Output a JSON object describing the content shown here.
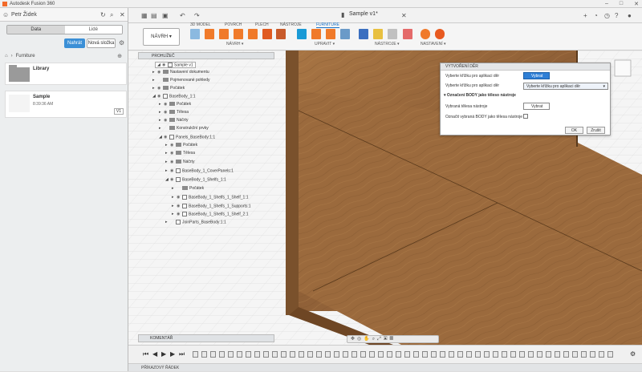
{
  "window": {
    "title": "Autodesk Fusion 360"
  },
  "data_panel": {
    "user": "Petr Židek",
    "tabs": [
      "Data",
      "Lidé"
    ],
    "buttons": {
      "upload": "Nahrát",
      "new_folder": "Nová složka"
    },
    "breadcrumb": "Furniture",
    "items": [
      {
        "name": "Library",
        "time": ""
      },
      {
        "name": "Sample",
        "time": "8:39:36 AM",
        "version": "V1"
      }
    ]
  },
  "app": {
    "tab_title": "Sample v1*"
  },
  "toolbar": {
    "workspace": "NÁVRH",
    "modes": [
      "3D MODEL",
      "POVRCH",
      "PLECH",
      "NÁSTROJE",
      "FURNITURE"
    ],
    "groups": [
      "NÁVRH",
      "UPRAVIT",
      "NÁSTROJE",
      "NASTAVENÍ"
    ]
  },
  "browser": {
    "header": "PROHLÍŽEČ",
    "nodes": [
      {
        "label": "Sample v1"
      },
      {
        "label": "Nastavení dokumentu"
      },
      {
        "label": "Pojmenované pohledy"
      },
      {
        "label": "Počátek"
      },
      {
        "label": "BaseBody_1:1"
      },
      {
        "label": "Počátek"
      },
      {
        "label": "Tělesa"
      },
      {
        "label": "Náčrty"
      },
      {
        "label": "Konstrukční prvky"
      },
      {
        "label": "Panels_BaseBody:1:1"
      },
      {
        "label": "Počátek"
      },
      {
        "label": "Tělesa"
      },
      {
        "label": "Náčrty"
      },
      {
        "label": "BaseBody_1_CoverPanels:1"
      },
      {
        "label": "BaseBody_1_Shelfs_1:1"
      },
      {
        "label": "Počátek"
      },
      {
        "label": "BaseBody_1_Shelfs_1_Shelf_1:1"
      },
      {
        "label": "BaseBody_1_Shelfs_1_Supports:1"
      },
      {
        "label": "BaseBody_1_Shelfs_1_Shelf_2:1"
      },
      {
        "label": "JoinParts_BaseBody:1:1"
      }
    ]
  },
  "comments": {
    "label": "KOMENTÁŘ"
  },
  "command_line": {
    "label": "PŘÍKAZOVÝ ŘÁDEK"
  },
  "dialog": {
    "title": "VYTVOŘENÍ DĚR",
    "row1_label": "Vyberte křížku pro aplikaci děr",
    "row1_button": "Vybrat",
    "row2_label": "Vyberte křížku pro aplikaci děr",
    "row2_dropdown": "Vyberte křížku pro aplikaci děr",
    "section": "Označení BODY jako těleso nástroje",
    "row3_label": "Vybraná tělesa nástroje",
    "row3_button": "Vybrat",
    "row4_label": "Označit vybraná BODY jako tělesa nástroje",
    "ok": "OK",
    "cancel": "Zrušit"
  },
  "colors": {
    "accent": "#2f7fd6",
    "wood": "#9a6a3e",
    "orange": "#f26a2a"
  }
}
